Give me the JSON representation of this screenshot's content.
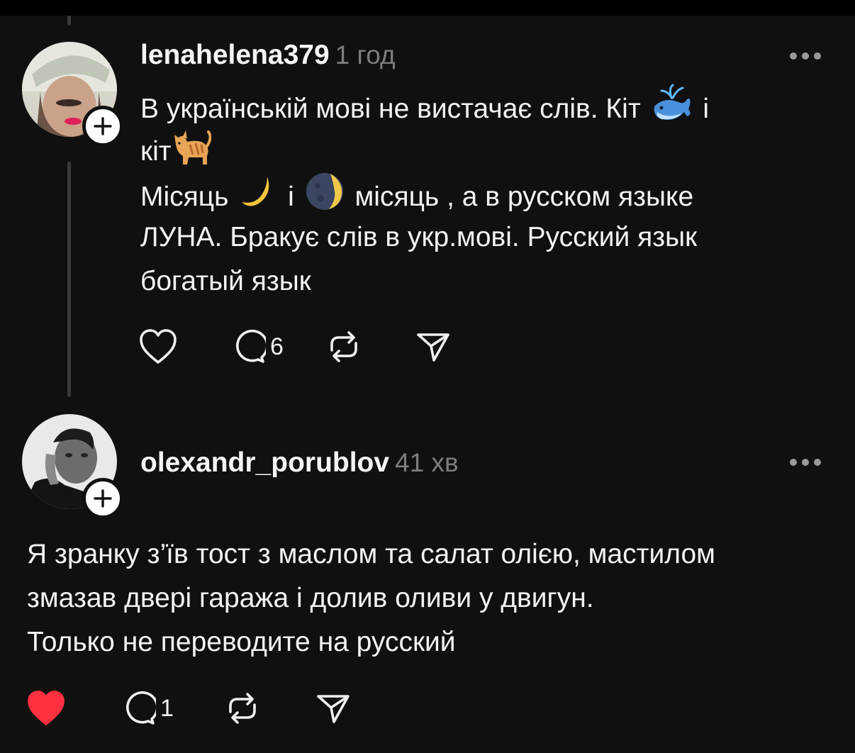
{
  "posts": [
    {
      "username": "lenahelena379",
      "time": "1 год",
      "text": {
        "l1_a": "В українській мові не вистачає слів. Кіт",
        "l1_b": "і",
        "l2_a": "кіт",
        "l3_a": "Місяць",
        "l3_b": "і",
        "l3_c": "місяць , а в русском языке",
        "l4": "ЛУНА. Бракує слів в укр.мові. Русский язык",
        "l5": "богатый язык"
      },
      "emoji": [
        "whale-emoji",
        "cat-emoji",
        "crescent-moon-emoji",
        "moon-phase-emoji"
      ],
      "liked": false,
      "like_count": "",
      "reply_count": "6"
    },
    {
      "username": "olexandr_porublov",
      "time": "41 хв",
      "text": {
        "l1": "Я зранку з’їв тост з маслом та салат олією, мастилом",
        "l2": "змазав двері гаража і долив оливи у двигун.",
        "l3": "Только не переводите на русский"
      },
      "liked": true,
      "like_count": "",
      "reply_count": "1"
    }
  ],
  "icons": {
    "like": "heart-icon",
    "reply": "comment-icon",
    "repost": "repost-icon",
    "share": "send-icon",
    "more": "more-dots-icon",
    "follow": "plus-icon"
  },
  "colors": {
    "background": "#101010",
    "like_active": "#ff3040",
    "muted": "#7d7d7d"
  }
}
